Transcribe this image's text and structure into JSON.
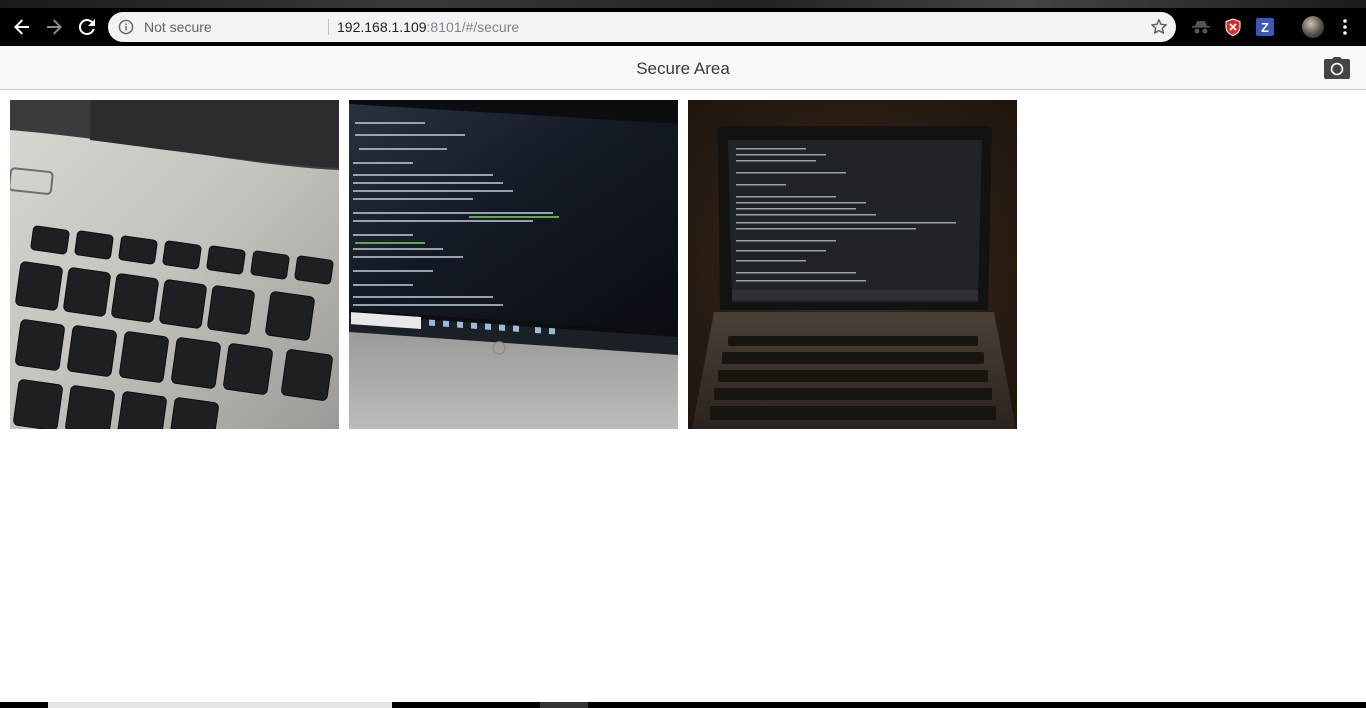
{
  "browser": {
    "security_label": "Not secure",
    "url_host": "192.168.1.109",
    "url_rest": ":8101/#/secure"
  },
  "header": {
    "title": "Secure Area"
  },
  "photos": [
    {
      "subject": "laptop-keyboard-closeup"
    },
    {
      "subject": "laptop-screen-terminal"
    },
    {
      "subject": "laptop-dark-room"
    }
  ],
  "icons": {
    "back": "arrow-left-icon",
    "forward": "arrow-right-icon",
    "reload": "reload-icon",
    "info": "info-icon",
    "bookmark": "star-icon",
    "camera": "camera-icon",
    "menu": "kebab-menu-icon"
  },
  "ext_z_label": "Z",
  "colors": {
    "header_bg": "#f8f8f8",
    "title_text": "#3a3a3a",
    "chrome_bg": "#000000",
    "omnibox_bg": "#f1f3f4"
  }
}
